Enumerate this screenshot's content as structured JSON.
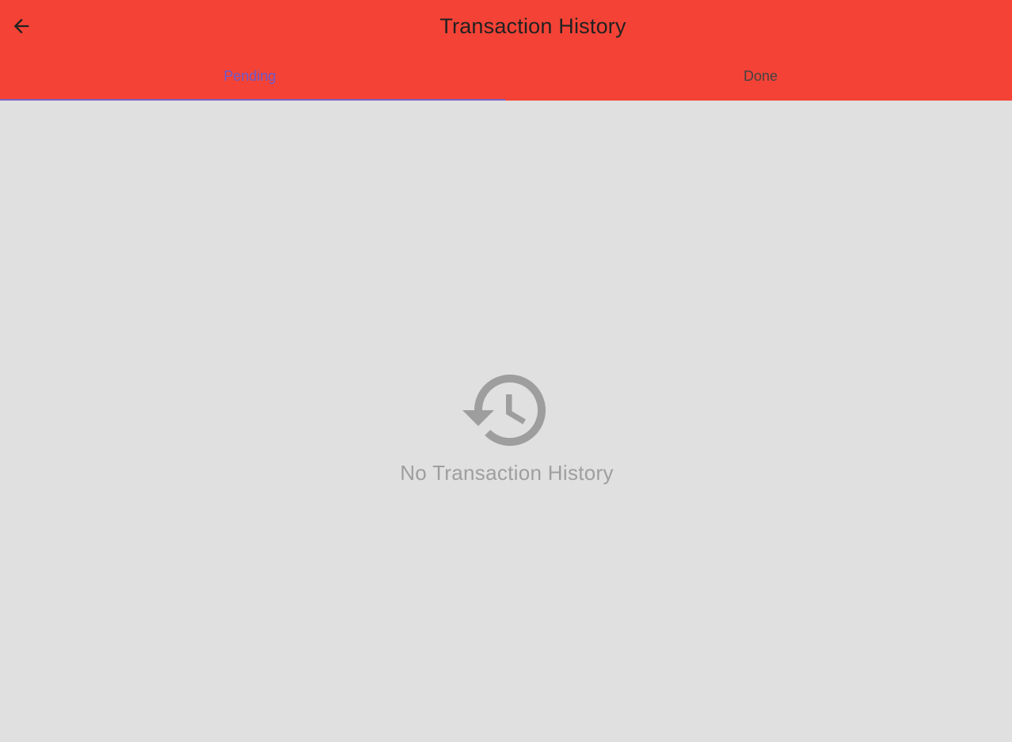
{
  "app_bar": {
    "title": "Transaction History",
    "back_icon": "arrow-back-icon",
    "background_color": "#f44336"
  },
  "tabs": [
    {
      "label": "Pending",
      "selected": true,
      "color": "#6a5acd"
    },
    {
      "label": "Done",
      "selected": false,
      "color": "#424242"
    }
  ],
  "empty_state": {
    "icon": "history-icon",
    "message": "No Transaction History",
    "color": "#9e9e9e"
  }
}
